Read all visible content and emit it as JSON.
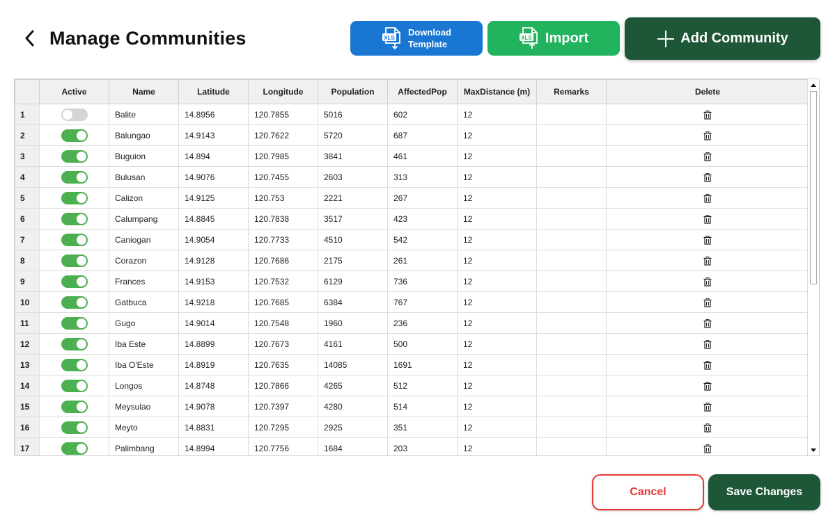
{
  "header": {
    "title": "Manage Communities",
    "back_icon": "chevron-left-icon",
    "download_line1": "Download",
    "download_line2": "Template",
    "import_label": "Import",
    "add_label": "Add Community",
    "xls_badge": "XLS"
  },
  "colors": {
    "download_bg": "#1976d2",
    "import_bg": "#22b35e",
    "primary_dark": "#1e5638",
    "toggle_on": "#4caf50",
    "toggle_off": "#d4d4d4",
    "cancel_red": "#e53935"
  },
  "table": {
    "columns": [
      "",
      "Active",
      "Name",
      "Latitude",
      "Longitude",
      "Population",
      "AffectedPop",
      "MaxDistance (m)",
      "Remarks",
      "Delete"
    ],
    "rows": [
      {
        "n": "1",
        "active": false,
        "name": "Balite",
        "lat": "14.8956",
        "lon": "120.7855",
        "pop": "5016",
        "aff": "602",
        "maxd": "12",
        "remarks": ""
      },
      {
        "n": "2",
        "active": true,
        "name": "Balungao",
        "lat": "14.9143",
        "lon": "120.7622",
        "pop": "5720",
        "aff": "687",
        "maxd": "12",
        "remarks": ""
      },
      {
        "n": "3",
        "active": true,
        "name": "Buguion",
        "lat": "14.894",
        "lon": "120.7985",
        "pop": "3841",
        "aff": "461",
        "maxd": "12",
        "remarks": ""
      },
      {
        "n": "4",
        "active": true,
        "name": "Bulusan",
        "lat": "14.9076",
        "lon": "120.7455",
        "pop": "2603",
        "aff": "313",
        "maxd": "12",
        "remarks": ""
      },
      {
        "n": "5",
        "active": true,
        "name": "Calizon",
        "lat": "14.9125",
        "lon": "120.753",
        "pop": "2221",
        "aff": "267",
        "maxd": "12",
        "remarks": ""
      },
      {
        "n": "6",
        "active": true,
        "name": "Calumpang",
        "lat": "14.8845",
        "lon": "120.7838",
        "pop": "3517",
        "aff": "423",
        "maxd": "12",
        "remarks": ""
      },
      {
        "n": "7",
        "active": true,
        "name": "Caniogan",
        "lat": "14.9054",
        "lon": "120.7733",
        "pop": "4510",
        "aff": "542",
        "maxd": "12",
        "remarks": ""
      },
      {
        "n": "8",
        "active": true,
        "name": "Corazon",
        "lat": "14.9128",
        "lon": "120.7686",
        "pop": "2175",
        "aff": "261",
        "maxd": "12",
        "remarks": ""
      },
      {
        "n": "9",
        "active": true,
        "name": "Frances",
        "lat": "14.9153",
        "lon": "120.7532",
        "pop": "6129",
        "aff": "736",
        "maxd": "12",
        "remarks": ""
      },
      {
        "n": "10",
        "active": true,
        "name": "Gatbuca",
        "lat": "14.9218",
        "lon": "120.7685",
        "pop": "6384",
        "aff": "767",
        "maxd": "12",
        "remarks": ""
      },
      {
        "n": "11",
        "active": true,
        "name": "Gugo",
        "lat": "14.9014",
        "lon": "120.7548",
        "pop": "1960",
        "aff": "236",
        "maxd": "12",
        "remarks": ""
      },
      {
        "n": "12",
        "active": true,
        "name": "Iba Este",
        "lat": "14.8899",
        "lon": "120.7673",
        "pop": "4161",
        "aff": "500",
        "maxd": "12",
        "remarks": ""
      },
      {
        "n": "13",
        "active": true,
        "name": "Iba O'Este",
        "lat": "14.8919",
        "lon": "120.7635",
        "pop": "14085",
        "aff": "1691",
        "maxd": "12",
        "remarks": ""
      },
      {
        "n": "14",
        "active": true,
        "name": "Longos",
        "lat": "14.8748",
        "lon": "120.7866",
        "pop": "4265",
        "aff": "512",
        "maxd": "12",
        "remarks": ""
      },
      {
        "n": "15",
        "active": true,
        "name": "Meysulao",
        "lat": "14.9078",
        "lon": "120.7397",
        "pop": "4280",
        "aff": "514",
        "maxd": "12",
        "remarks": ""
      },
      {
        "n": "16",
        "active": true,
        "name": "Meyto",
        "lat": "14.8831",
        "lon": "120.7295",
        "pop": "2925",
        "aff": "351",
        "maxd": "12",
        "remarks": ""
      },
      {
        "n": "17",
        "active": true,
        "name": "Palimbang",
        "lat": "14.8994",
        "lon": "120.7756",
        "pop": "1684",
        "aff": "203",
        "maxd": "12",
        "remarks": ""
      }
    ]
  },
  "footer": {
    "cancel_label": "Cancel",
    "save_label": "Save Changes"
  }
}
